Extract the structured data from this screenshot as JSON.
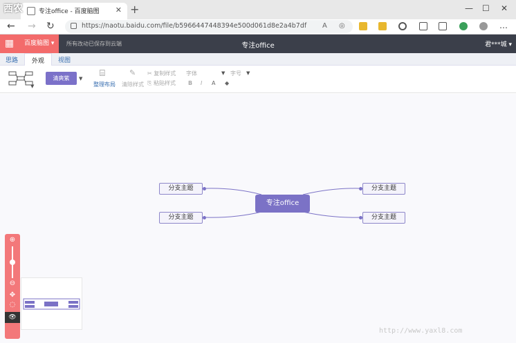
{
  "watermark_top": "西农",
  "watermark_bottom": "http://www.yaxl8.com",
  "browser": {
    "tab_title": "专注office - 百度脑图",
    "tab_close": "✕",
    "new_tab": "+",
    "url": "https://naotu.baidu.com/file/b5966447448394e500d061d8e2a4b7df",
    "controls": {
      "min": "—",
      "max": "☐",
      "close": "✕"
    }
  },
  "app": {
    "brand": "百度脑图 ▾",
    "save_hint": "所有改动已保存到云端",
    "doc_title": "专注office",
    "user": "君***城 ▾"
  },
  "menu_tabs": [
    "思路",
    "外观",
    "视图"
  ],
  "toolbar": {
    "theme_label": "清爽紫",
    "clear_style": "整理布局",
    "clear_format": "清除样式",
    "copy_style": "复制样式",
    "paste_style": "粘贴样式",
    "font_family": "字体",
    "font_size": "字号",
    "bold": "B",
    "italic": "I",
    "font_color": "A",
    "bg_color": "◆"
  },
  "mindmap": {
    "root": "专注office",
    "left_branches": [
      "分支主题",
      "分支主题"
    ],
    "right_branches": [
      "分支主题",
      "分支主题"
    ]
  },
  "zoom": {
    "zoom_in": "⊕",
    "zoom_out": "⊖",
    "move": "✥",
    "locate": "◌",
    "eye": "👁"
  },
  "colors": {
    "accent": "#7b72c6",
    "brand_red": "#f36b6b",
    "header": "#3b3f4a"
  }
}
